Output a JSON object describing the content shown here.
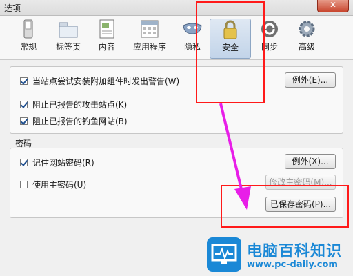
{
  "window": {
    "title": "选项",
    "close_label": "✕"
  },
  "toolbar": {
    "items": [
      {
        "label": "常规",
        "icon": "switch-icon"
      },
      {
        "label": "标签页",
        "icon": "folder-tabs-icon"
      },
      {
        "label": "内容",
        "icon": "page-icon"
      },
      {
        "label": "应用程序",
        "icon": "calendar-icon"
      },
      {
        "label": "隐私",
        "icon": "mask-icon"
      },
      {
        "label": "安全",
        "icon": "lock-icon",
        "active": true
      },
      {
        "label": "同步",
        "icon": "sync-icon"
      },
      {
        "label": "高级",
        "icon": "gear-icon"
      }
    ]
  },
  "security": {
    "warn_addons": {
      "label": "当站点尝试安装附加组件时发出警告(W)",
      "checked": true
    },
    "exceptions_1": "例外(E)...",
    "block_attack": {
      "label": "阻止已报告的攻击站点(K)",
      "checked": true
    },
    "block_forgery": {
      "label": "阻止已报告的钓鱼网站(B)",
      "checked": true
    }
  },
  "passwords": {
    "section_title": "密码",
    "remember": {
      "label": "记住网站密码(R)",
      "checked": true
    },
    "exceptions_2": "例外(X)...",
    "master": {
      "label": "使用主密码(U)",
      "checked": false
    },
    "change_master": "修改主密码(M)...",
    "saved_passwords": "已保存密码(P)..."
  },
  "watermark": {
    "title": "电脑百科知识",
    "url": "www.pc-daily.com"
  },
  "colors": {
    "annotation": "#ff1a1a",
    "arrow": "#e81ee8",
    "watermark": "#1a88d6"
  }
}
